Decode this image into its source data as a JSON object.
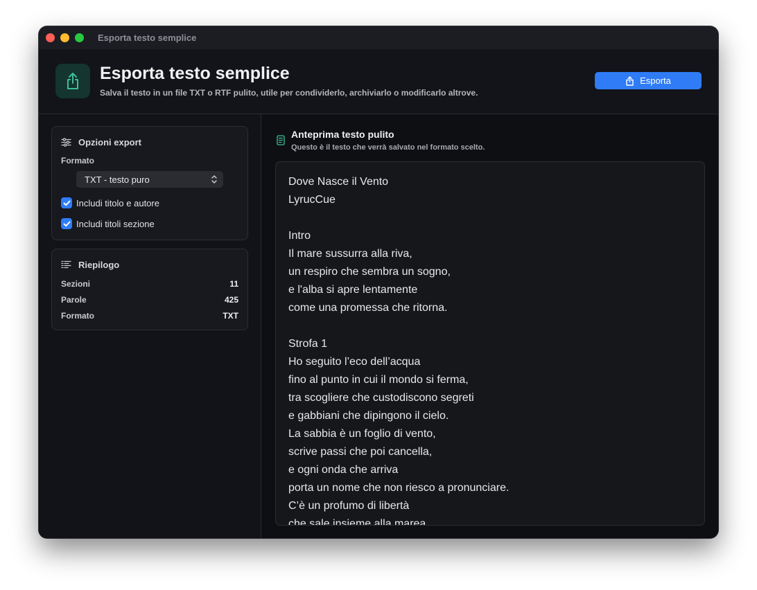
{
  "window": {
    "title": "Esporta testo semplice"
  },
  "header": {
    "title": "Esporta testo semplice",
    "subtitle": "Salva il testo in un file TXT o RTF pulito, utile per condividerlo, archiviarlo o modificarlo altrove.",
    "export_label": "Esporta",
    "icon": "share-icon",
    "accent": "#2f7cf6",
    "icon_color": "#3fbf98"
  },
  "options": {
    "title": "Opzioni export",
    "format_label": "Formato",
    "format_value": "TXT - testo puro",
    "include_title_author": "Includi titolo e autore",
    "include_section_titles": "Includi titoli sezione",
    "include_title_author_checked": true,
    "include_section_titles_checked": true
  },
  "summary": {
    "title": "Riepilogo",
    "rows": [
      {
        "label": "Sezioni",
        "value": "11"
      },
      {
        "label": "Parole",
        "value": "425"
      },
      {
        "label": "Formato",
        "value": "TXT"
      }
    ]
  },
  "preview": {
    "title": "Anteprima testo pulito",
    "subtitle": "Questo è il testo che verrà salvato nel formato scelto.",
    "text": "Dove Nasce il Vento\nLyrucCue\n\nIntro\nIl mare sussurra alla riva,\nun respiro che sembra un sogno,\ne l'alba si apre lentamente\ncome una promessa che ritorna.\n\nStrofa 1\nHo seguito l’eco dell’acqua\nfino al punto in cui il mondo si ferma,\ntra scogliere che custodiscono segreti\ne gabbiani che dipingono il cielo.\nLa sabbia è un foglio di vento,\nscrive passi che poi cancella,\ne ogni onda che arriva\nporta un nome che non riesco a pronunciare.\nC’è un profumo di libertà\nche sale insieme alla marea"
  }
}
